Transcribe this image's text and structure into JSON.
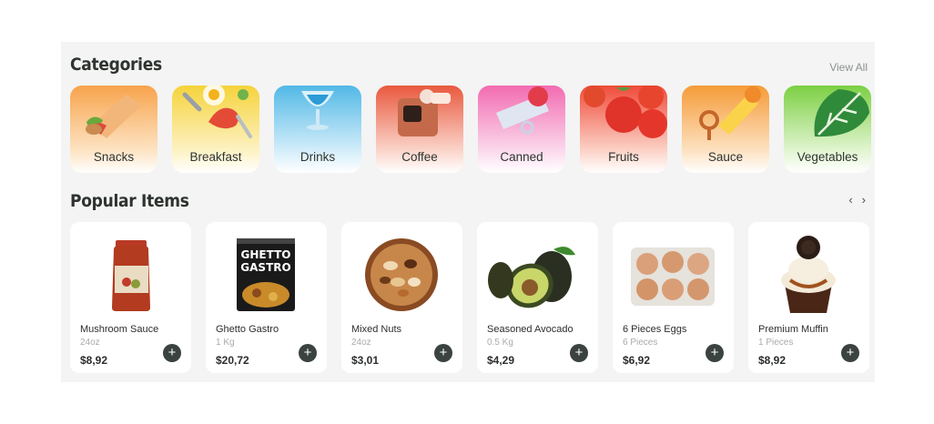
{
  "categories_section": {
    "title": "Categories",
    "view_all": "View All",
    "items": [
      {
        "label": "Snacks",
        "icon": "snacks-icon",
        "bg_top": "#f7a34c",
        "bg_bottom": "#fde4c4"
      },
      {
        "label": "Breakfast",
        "icon": "breakfast-icon",
        "bg_top": "#f5d33b",
        "bg_bottom": "#fdf2c4"
      },
      {
        "label": "Drinks",
        "icon": "drinks-icon",
        "bg_top": "#52b8e6",
        "bg_bottom": "#d4eefa"
      },
      {
        "label": "Coffee",
        "icon": "coffee-icon",
        "bg_top": "#e9593f",
        "bg_bottom": "#fbd5cb"
      },
      {
        "label": "Canned",
        "icon": "canned-icon",
        "bg_top": "#f26bb1",
        "bg_bottom": "#fbd9ec"
      },
      {
        "label": "Fruits",
        "icon": "fruits-icon",
        "bg_top": "#ef4b3a",
        "bg_bottom": "#fcd3c8"
      },
      {
        "label": "Sauce",
        "icon": "sauce-icon",
        "bg_top": "#f59b38",
        "bg_bottom": "#fde2c2"
      },
      {
        "label": "Vegetables",
        "icon": "vegetables-icon",
        "bg_top": "#7ccf43",
        "bg_bottom": "#e2f5d2"
      }
    ]
  },
  "popular_section": {
    "title": "Popular Items",
    "prev_label": "‹",
    "next_label": "›",
    "add_label": "+",
    "items": [
      {
        "name": "Mushroom Sauce",
        "qty": "24oz",
        "price": "$8,92",
        "image": "sauce-jar-image"
      },
      {
        "name": "Ghetto Gastro",
        "qty": "1 Kg",
        "price": "$20,72",
        "image": "ghetto-gastro-tin-image",
        "tin_text_1": "GHETTO",
        "tin_text_2": "GASTRO"
      },
      {
        "name": "Mixed Nuts",
        "qty": "24oz",
        "price": "$3,01",
        "image": "mixed-nuts-bowl-image"
      },
      {
        "name": "Seasoned Avocado",
        "qty": "0.5 Kg",
        "price": "$4,29",
        "image": "avocado-image"
      },
      {
        "name": "6 Pieces Eggs",
        "qty": "6 Pieces",
        "price": "$6,92",
        "image": "egg-carton-image"
      },
      {
        "name": "Premium Muffin",
        "qty": "1 Pieces",
        "price": "$8,92",
        "image": "muffin-image"
      }
    ]
  }
}
